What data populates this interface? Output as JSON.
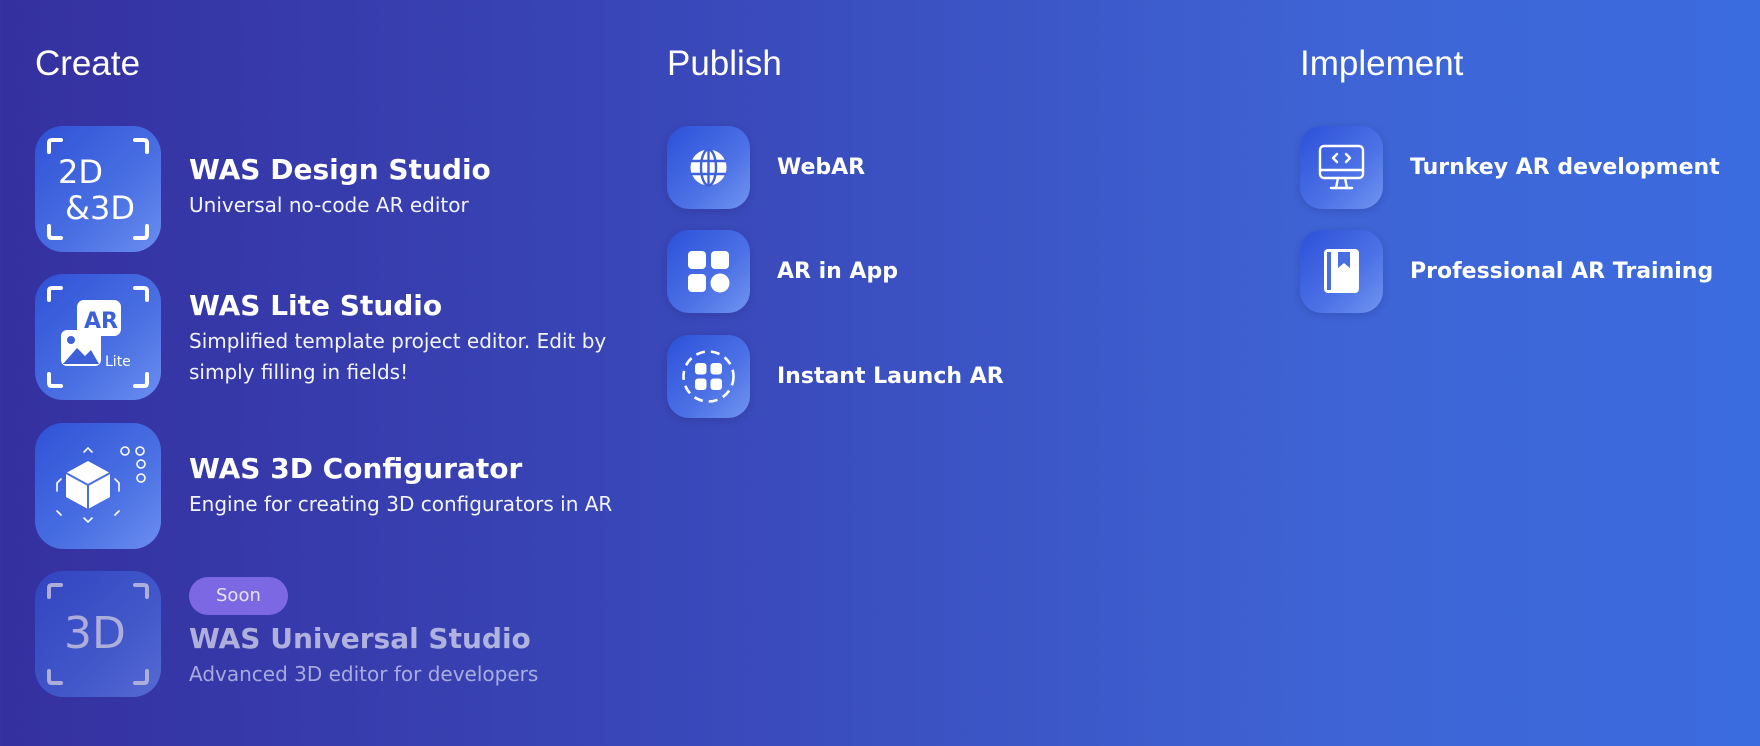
{
  "columns": {
    "create": {
      "title": "Create",
      "items": [
        {
          "title": "WAS Design Studio",
          "description": "Universal no-code AR editor",
          "icon": "design-studio-2d-3d-icon",
          "icon_text": [
            "2D",
            "&3D"
          ]
        },
        {
          "title": "WAS Lite Studio",
          "description": "Simplified template project editor. Edit by simply filling in fields!",
          "icon": "lite-studio-ar-icon",
          "icon_text": [
            "AR",
            "Lite"
          ]
        },
        {
          "title": "WAS 3D Configurator",
          "description": "Engine for creating 3D configurators in AR",
          "icon": "cube-configurator-icon"
        },
        {
          "title": "WAS Universal Studio",
          "description": "Advanced 3D editor for developers",
          "icon": "universal-studio-3d-icon",
          "icon_text": [
            "3D"
          ],
          "badge": "Soon"
        }
      ]
    },
    "publish": {
      "title": "Publish",
      "items": [
        {
          "label": "WebAR",
          "icon": "globe-icon"
        },
        {
          "label": "AR in App",
          "icon": "app-grid-icon"
        },
        {
          "label": "Instant Launch AR",
          "icon": "instant-launch-icon"
        }
      ]
    },
    "implement": {
      "title": "Implement",
      "items": [
        {
          "label": "Turnkey AR development",
          "icon": "code-monitor-icon"
        },
        {
          "label": "Professional AR Training",
          "icon": "book-bookmark-icon"
        }
      ]
    }
  },
  "colors": {
    "background_start": "#3530a0",
    "background_end": "#3b6cdf",
    "badge": "#7d68e3",
    "icon_tile": "#4a70e3"
  }
}
